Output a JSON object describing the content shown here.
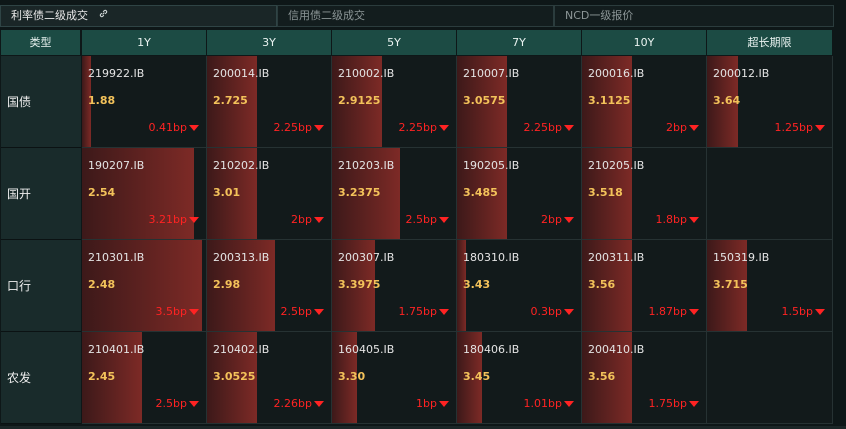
{
  "tabs": [
    {
      "label": "利率债二级成交",
      "active": true
    },
    {
      "label": "信用债二级成交",
      "active": false
    },
    {
      "label": "NCD一级报价",
      "active": false
    }
  ],
  "table": {
    "type_header": "类型",
    "columns": [
      "1Y",
      "3Y",
      "5Y",
      "7Y",
      "10Y",
      "超长期限"
    ],
    "rows": [
      {
        "label": "国债",
        "cells": [
          {
            "code": "219922.IB",
            "yield": "1.88",
            "change": "0.41bp",
            "level": 0.07
          },
          {
            "code": "200014.IB",
            "yield": "2.725",
            "change": "2.25bp",
            "level": 0.4
          },
          {
            "code": "210002.IB",
            "yield": "2.9125",
            "change": "2.25bp",
            "level": 0.4
          },
          {
            "code": "210007.IB",
            "yield": "3.0575",
            "change": "2.25bp",
            "level": 0.4
          },
          {
            "code": "200016.IB",
            "yield": "3.1125",
            "change": "2bp",
            "level": 0.4
          },
          {
            "code": "200012.IB",
            "yield": "3.64",
            "change": "1.25bp",
            "level": 0.25
          }
        ]
      },
      {
        "label": "国开",
        "cells": [
          {
            "code": "190207.IB",
            "yield": "2.54",
            "change": "3.21bp",
            "level": 0.9
          },
          {
            "code": "210202.IB",
            "yield": "3.01",
            "change": "2bp",
            "level": 0.4
          },
          {
            "code": "210203.IB",
            "yield": "3.2375",
            "change": "2.5bp",
            "level": 0.55
          },
          {
            "code": "190205.IB",
            "yield": "3.485",
            "change": "2bp",
            "level": 0.4
          },
          {
            "code": "210205.IB",
            "yield": "3.518",
            "change": "1.8bp",
            "level": 0.4
          },
          null
        ]
      },
      {
        "label": "口行",
        "cells": [
          {
            "code": "210301.IB",
            "yield": "2.48",
            "change": "3.5bp",
            "level": 0.97
          },
          {
            "code": "200313.IB",
            "yield": "2.98",
            "change": "2.5bp",
            "level": 0.55
          },
          {
            "code": "200307.IB",
            "yield": "3.3975",
            "change": "1.75bp",
            "level": 0.35
          },
          {
            "code": "180310.IB",
            "yield": "3.43",
            "change": "0.3bp",
            "level": 0.07
          },
          {
            "code": "200311.IB",
            "yield": "3.56",
            "change": "1.87bp",
            "level": 0.4
          },
          {
            "code": "150319.IB",
            "yield": "3.715",
            "change": "1.5bp",
            "level": 0.32
          }
        ]
      },
      {
        "label": "农发",
        "cells": [
          {
            "code": "210401.IB",
            "yield": "2.45",
            "change": "2.5bp",
            "level": 0.48
          },
          {
            "code": "210402.IB",
            "yield": "3.0525",
            "change": "2.26bp",
            "level": 0.4
          },
          {
            "code": "160405.IB",
            "yield": "3.30",
            "change": "1bp",
            "level": 0.2
          },
          {
            "code": "180406.IB",
            "yield": "3.45",
            "change": "1.01bp",
            "level": 0.2
          },
          {
            "code": "200410.IB",
            "yield": "3.56",
            "change": "1.75bp",
            "level": 0.4
          },
          null
        ]
      }
    ]
  }
}
